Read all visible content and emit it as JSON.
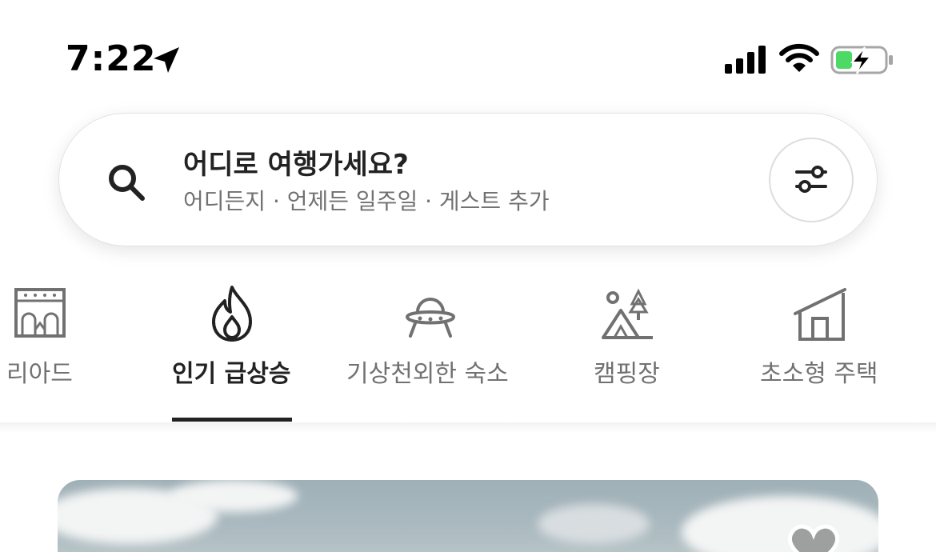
{
  "status_bar": {
    "time": "7:22",
    "icons": [
      "location-arrow-icon",
      "cellular-signal-icon",
      "wifi-icon",
      "battery-charging-icon"
    ],
    "battery_color": "#4cd964"
  },
  "search": {
    "title": "어디로 여행가세요?",
    "subtitle": "어디든지 · 언제든 일주일 · 게스트 추가",
    "icon": "search-icon",
    "filter_icon": "filter-sliders-icon"
  },
  "categories": {
    "active_index": 1,
    "items": [
      {
        "label": "리아드",
        "icon": "riad-building-icon"
      },
      {
        "label": "인기 급상승",
        "icon": "flame-icon"
      },
      {
        "label": "기상천외한 숙소",
        "icon": "ufo-icon"
      },
      {
        "label": "캠핑장",
        "icon": "tent-icon"
      },
      {
        "label": "초소형 주택",
        "icon": "tiny-house-icon"
      }
    ]
  },
  "colors": {
    "text_primary": "#222222",
    "text_secondary": "#717171",
    "border": "#dddddd"
  }
}
